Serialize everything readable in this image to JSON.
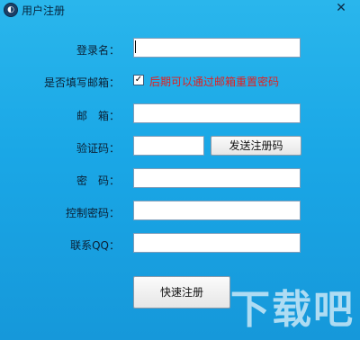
{
  "window": {
    "title": "用户注册",
    "close_glyph": "✕",
    "icon_glyph": "◐"
  },
  "form": {
    "username": {
      "label": "登录名：",
      "value": ""
    },
    "fill_email": {
      "label": "是否填写邮箱：",
      "checked": true,
      "checkbox_text": "后期可以通过邮箱重置密码",
      "check_glyph": "✓"
    },
    "email": {
      "label": "邮　箱：",
      "value": ""
    },
    "verify_code": {
      "label": "验证码：",
      "value": ""
    },
    "send_code_button": "发送注册码",
    "password": {
      "label": "密　码：",
      "value": ""
    },
    "control_password": {
      "label": "控制密码：",
      "value": ""
    },
    "qq": {
      "label": "联系QQ：",
      "value": ""
    },
    "submit_button": "快速注册"
  },
  "watermark": "下载吧"
}
